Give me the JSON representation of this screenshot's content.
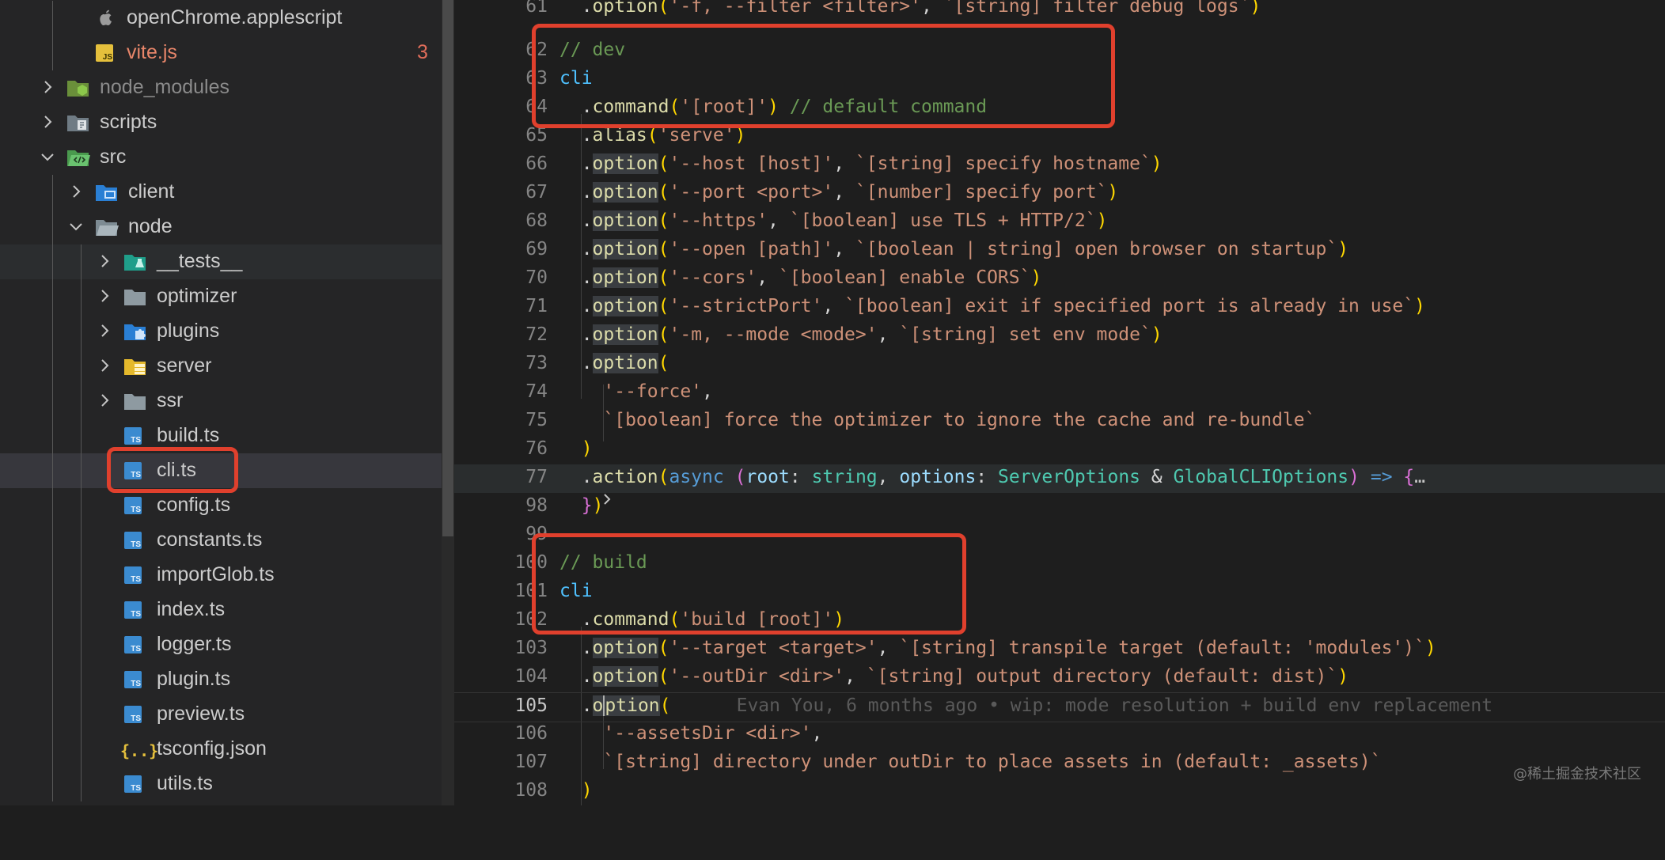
{
  "sidebar": {
    "items": [
      {
        "label": "openChrome.applescript",
        "icon": "apple-icon",
        "type": "file",
        "color": "#cccccc"
      },
      {
        "label": "vite.js",
        "icon": "js-file-icon",
        "type": "file",
        "color": "#e8866a",
        "badge": "3"
      },
      {
        "label": "node_modules",
        "icon": "node-modules-folder-icon",
        "type": "folder",
        "color": "#8b8b8b"
      },
      {
        "label": "scripts",
        "icon": "scripts-folder-icon",
        "type": "folder",
        "color": "#cccccc"
      },
      {
        "label": "src",
        "icon": "src-folder-icon",
        "type": "folder",
        "color": "#cccccc"
      },
      {
        "label": "client",
        "icon": "client-folder-icon",
        "type": "folder",
        "color": "#cccccc"
      },
      {
        "label": "node",
        "icon": "folder-open-icon",
        "type": "folder",
        "color": "#cccccc"
      },
      {
        "label": "__tests__",
        "icon": "tests-folder-icon",
        "type": "folder",
        "color": "#cccccc"
      },
      {
        "label": "optimizer",
        "icon": "folder-icon",
        "type": "folder",
        "color": "#cccccc"
      },
      {
        "label": "plugins",
        "icon": "plugins-folder-icon",
        "type": "folder",
        "color": "#cccccc"
      },
      {
        "label": "server",
        "icon": "server-folder-icon",
        "type": "folder",
        "color": "#cccccc"
      },
      {
        "label": "ssr",
        "icon": "folder-icon",
        "type": "folder",
        "color": "#cccccc"
      },
      {
        "label": "build.ts",
        "icon": "ts-file-icon",
        "type": "file",
        "color": "#cccccc"
      },
      {
        "label": "cli.ts",
        "icon": "ts-file-icon",
        "type": "file",
        "color": "#cccccc"
      },
      {
        "label": "config.ts",
        "icon": "ts-file-icon",
        "type": "file",
        "color": "#cccccc"
      },
      {
        "label": "constants.ts",
        "icon": "ts-file-icon",
        "type": "file",
        "color": "#cccccc"
      },
      {
        "label": "importGlob.ts",
        "icon": "ts-file-icon",
        "type": "file",
        "color": "#cccccc"
      },
      {
        "label": "index.ts",
        "icon": "ts-file-icon",
        "type": "file",
        "color": "#cccccc"
      },
      {
        "label": "logger.ts",
        "icon": "ts-file-icon",
        "type": "file",
        "color": "#cccccc"
      },
      {
        "label": "plugin.ts",
        "icon": "ts-file-icon",
        "type": "file",
        "color": "#cccccc"
      },
      {
        "label": "preview.ts",
        "icon": "ts-file-icon",
        "type": "file",
        "color": "#cccccc"
      },
      {
        "label": "tsconfig.json",
        "icon": "json-file-icon",
        "type": "file",
        "color": "#cccccc"
      },
      {
        "label": "utils.ts",
        "icon": "ts-file-icon",
        "type": "file",
        "color": "#cccccc"
      }
    ]
  },
  "editor": {
    "line_numbers": [
      "61",
      "62",
      "63",
      "64",
      "65",
      "66",
      "67",
      "68",
      "69",
      "70",
      "71",
      "72",
      "73",
      "74",
      "75",
      "76",
      "77",
      "98",
      "99",
      "100",
      "101",
      "102",
      "103",
      "104",
      "105",
      "106",
      "107",
      "108"
    ],
    "folded_placeholder": "…",
    "blame": "Evan You, 6 months ago • wip: mode resolution + build env replacement"
  },
  "watermark": "@稀土掘金技术社区",
  "colors": {
    "annotation_red": "#e0402d",
    "sidebar_bg": "#252526",
    "editor_bg": "#1e1e1e"
  }
}
